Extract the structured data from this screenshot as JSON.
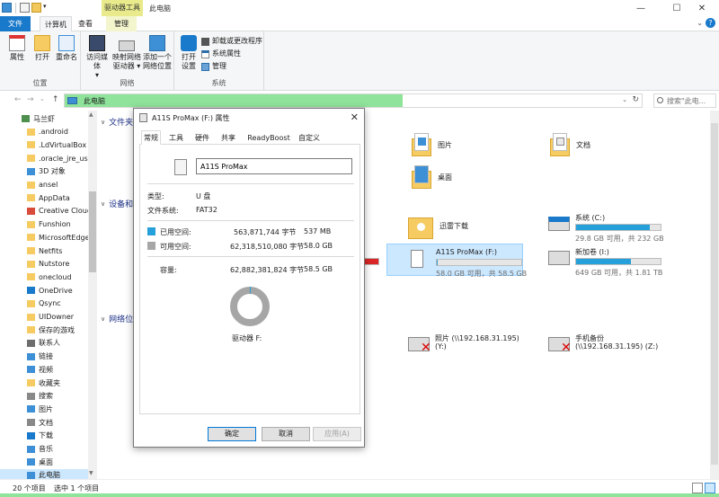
{
  "window": {
    "contextual_tab": "驱动器工具",
    "title": "此电脑",
    "minimize_glyph": "—",
    "maximize_glyph": "☐",
    "close_glyph": "✕"
  },
  "ribbon": {
    "tabs": {
      "file": "文件",
      "computer": "计算机",
      "view": "查看",
      "manage": "管理"
    },
    "location": {
      "label": "位置",
      "properties": "属性",
      "open": "打开",
      "rename": "重命名"
    },
    "network": {
      "label": "网络",
      "access_media_1": "访问媒体",
      "access_media_2": "▾",
      "map_drive_1": "映射网络",
      "map_drive_2": "驱动器 ▾",
      "add_location_1": "添加一个",
      "add_location_2": "网络位置"
    },
    "system": {
      "label": "系统",
      "open_settings_1": "打开",
      "open_settings_2": "设置",
      "uninstall": "卸载或更改程序",
      "system_properties": "系统属性",
      "manage": "管理"
    },
    "help_chevron": "⌄",
    "help_q": "?"
  },
  "addressbar": {
    "back": "←",
    "forward": "→",
    "recent": "⌄",
    "up": "↑",
    "path": "此电脑",
    "dropdown": "⌄",
    "refresh": "↻",
    "search_placeholder": "搜索\"此电..."
  },
  "nav": {
    "scroll_up": "▲",
    "scroll_down": "▼",
    "items": [
      {
        "label": "马兰虾"
      },
      {
        "label": ".android"
      },
      {
        "label": ".LdVirtualBox"
      },
      {
        "label": ".oracle_jre_usag"
      },
      {
        "label": "3D 对象"
      },
      {
        "label": "ansel"
      },
      {
        "label": "AppData"
      },
      {
        "label": "Creative Cloud"
      },
      {
        "label": "Funshion"
      },
      {
        "label": "MicrosoftEdgeI"
      },
      {
        "label": "Netfits"
      },
      {
        "label": "Nutstore"
      },
      {
        "label": "onecloud"
      },
      {
        "label": "OneDrive"
      },
      {
        "label": "Qsync"
      },
      {
        "label": "UIDowner"
      },
      {
        "label": "保存的游戏"
      },
      {
        "label": "联系人"
      },
      {
        "label": "链接"
      },
      {
        "label": "视频"
      },
      {
        "label": "收藏夹"
      },
      {
        "label": "搜索"
      },
      {
        "label": "图片"
      },
      {
        "label": "文档"
      },
      {
        "label": "下载"
      },
      {
        "label": "音乐"
      },
      {
        "label": "桌面"
      },
      {
        "label": "此电脑"
      }
    ]
  },
  "content": {
    "sections": {
      "folders": "文件夹",
      "devices": "设备和",
      "network": "网络位"
    },
    "folders": {
      "pictures": "图片",
      "documents": "文档",
      "desktop": "桌面"
    },
    "devices": {
      "xunlei": "迅雷下载",
      "c_name": "系统 (C:)",
      "c_free": "29.8 GB 可用，共 232 GB",
      "c_used_pct": 87,
      "f_name": "A11S ProMax (F:)",
      "f_free": "58.0 GB 可用，共 58.5 GB",
      "f_used_pct": 1,
      "i_name": "新加卷 (I:)",
      "i_free": "649 GB 可用，共 1.81 TB",
      "i_used_pct": 65,
      "hidden_free": "GB"
    },
    "network": {
      "photos_1": "照片 (\\\\192.168.31.195)",
      "photos_2": "(Y:)",
      "backup_1": "手机备份",
      "backup_2": "(\\\\192.168.31.195) (Z:)"
    }
  },
  "statusbar": {
    "count": "20 个项目",
    "selected": "选中 1 个项目"
  },
  "dialog": {
    "title": "A11S ProMax (F:) 属性",
    "close": "✕",
    "tabs": [
      "常规",
      "工具",
      "硬件",
      "共享",
      "ReadyBoost",
      "自定义"
    ],
    "volume_name": "A11S ProMax",
    "type_label": "类型:",
    "type_value": "U 盘",
    "fs_label": "文件系统:",
    "fs_value": "FAT32",
    "used_label": "已用空间:",
    "used_bytes": "563,871,744 字节",
    "used_size": "537 MB",
    "free_label": "可用空间:",
    "free_bytes": "62,318,510,080 字节",
    "free_size": "58.0 GB",
    "capacity_label": "容量:",
    "capacity_bytes": "62,882,381,824 字节",
    "capacity_size": "58.5 GB",
    "used_fraction": 0.009,
    "drive_label": "驱动器 F:",
    "ok": "确定",
    "cancel": "取消",
    "apply": "应用(A)",
    "colors": {
      "used": "#26a0da",
      "free": "#a6a6a6"
    }
  }
}
